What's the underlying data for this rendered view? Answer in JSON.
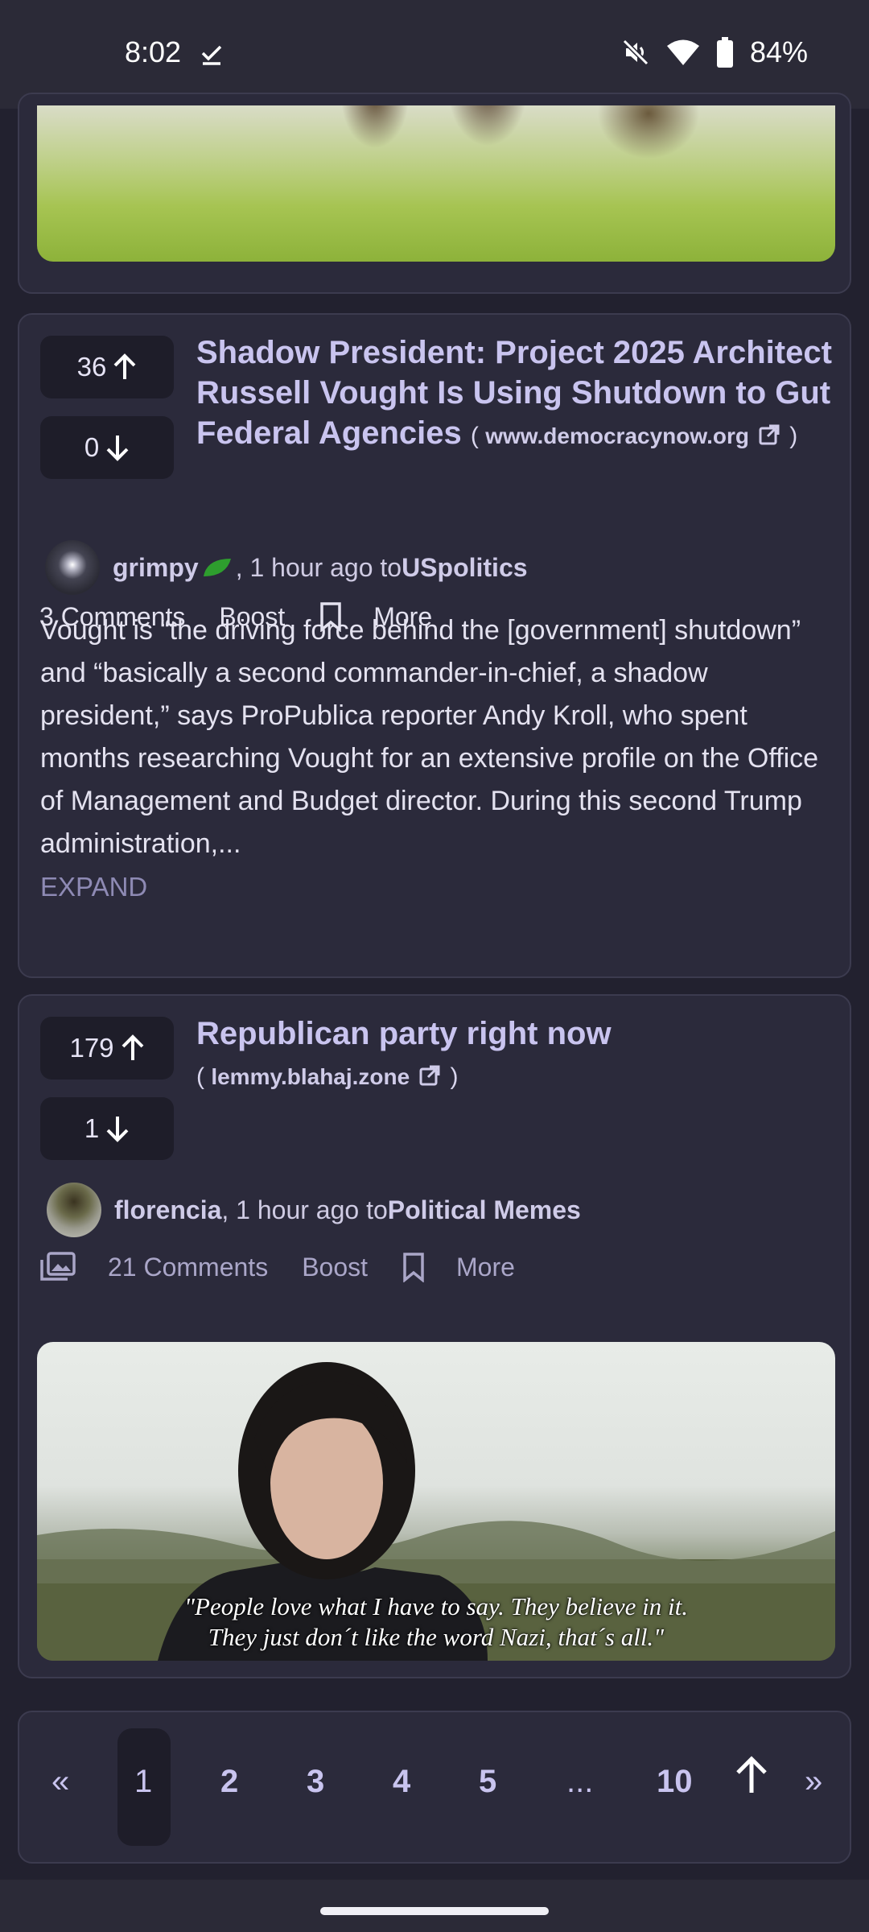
{
  "status_bar": {
    "time": "8:02",
    "battery": "84%"
  },
  "posts": [
    {
      "upvotes": "36",
      "downvotes": "0",
      "title": "Shadow President: Project 2025 Architect Russell Vought Is Using Shutdown to Gut Federal Agencies",
      "domain": "www.democracynow.org",
      "body": "Vought is “the driving force behind the [government] shutdown” and “basically a second commander-in-chief, a shadow president,” says ProPublica reporter Andy Kroll, who spent months researching Vought for an extensive profile on the Office of Management and Budget director. During this second Trump administration,...",
      "expand_label": "EXPAND",
      "author": "grimpy",
      "time_text": ", 1 hour ago to ",
      "community": "USpolitics",
      "comments_label": "3 Comments",
      "boost_label": "Boost",
      "more_label": "More"
    },
    {
      "upvotes": "179",
      "downvotes": "1",
      "title": "Republican party right now",
      "domain": "lemmy.blahaj.zone",
      "author": "florencia",
      "time_text": ", 1 hour ago to ",
      "community": "Political Memes",
      "comments_label": "21 Comments",
      "boost_label": "Boost",
      "more_label": "More",
      "image_caption_line1": "\"People love what I have to say. They believe in it.",
      "image_caption_line2": "They just don´t like the word Nazi, that´s all.\""
    }
  ],
  "pagination": {
    "prev": "«",
    "pages": [
      "1",
      "2",
      "3",
      "4",
      "5",
      "...",
      "10"
    ],
    "next": "»",
    "current": "1"
  },
  "colors": {
    "background": "#22212f",
    "card": "#2b2a3b",
    "accent_title": "#c9c4ef",
    "flair_green": "#2e9e2e"
  }
}
